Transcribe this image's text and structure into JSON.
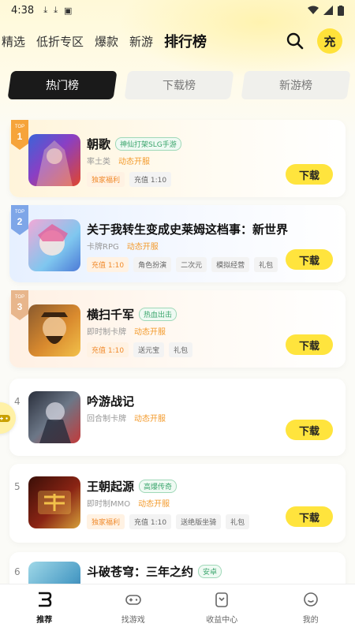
{
  "status_bar": {
    "time": "4:38"
  },
  "top_nav": {
    "tabs": [
      "精选",
      "低折专区",
      "爆款",
      "新游",
      "排行榜"
    ],
    "charge_label": "充"
  },
  "segments": [
    "热门榜",
    "下载榜",
    "新游榜"
  ],
  "games": [
    {
      "rank": "1",
      "name": "朝歌",
      "tag": "神仙打架SLG手游",
      "category": "率土类",
      "status": "动态开服",
      "chips": [
        "独家福利",
        "充值 1:10"
      ],
      "download": "下载"
    },
    {
      "rank": "2",
      "name": "关于我转生变成史莱姆这档事：新世界",
      "tag": "",
      "category": "卡牌RPG",
      "status": "动态开服",
      "chips": [
        "充值 1:10",
        "角色扮演",
        "二次元",
        "模拟经营",
        "礼包"
      ],
      "download": "下载"
    },
    {
      "rank": "3",
      "name": "横扫千军",
      "tag": "热血出击",
      "category": "即时制卡牌",
      "status": "动态开服",
      "chips": [
        "充值 1:10",
        "送元宝",
        "礼包"
      ],
      "download": "下载"
    },
    {
      "rank": "4",
      "name": "吟游战记",
      "tag": "",
      "category": "回合制卡牌",
      "status": "动态开服",
      "chips": [],
      "download": "下载"
    },
    {
      "rank": "5",
      "name": "王朝起源",
      "tag": "高爆传奇",
      "category": "即时制MMO",
      "status": "动态开服",
      "chips": [
        "独家福利",
        "充值 1:10",
        "送绝版坐骑",
        "礼包"
      ],
      "download": "下载"
    },
    {
      "rank": "6",
      "name": "斗破苍穹：三年之约",
      "tag": "安卓",
      "category": "",
      "status": "",
      "chips": [],
      "download": ""
    }
  ],
  "bottom_nav": [
    "推荐",
    "找游戏",
    "收益中心",
    "我的"
  ],
  "colors": {
    "accent": "#ffe43d",
    "status_orange": "#f39a2b",
    "tag_green": "#3aa56c"
  }
}
